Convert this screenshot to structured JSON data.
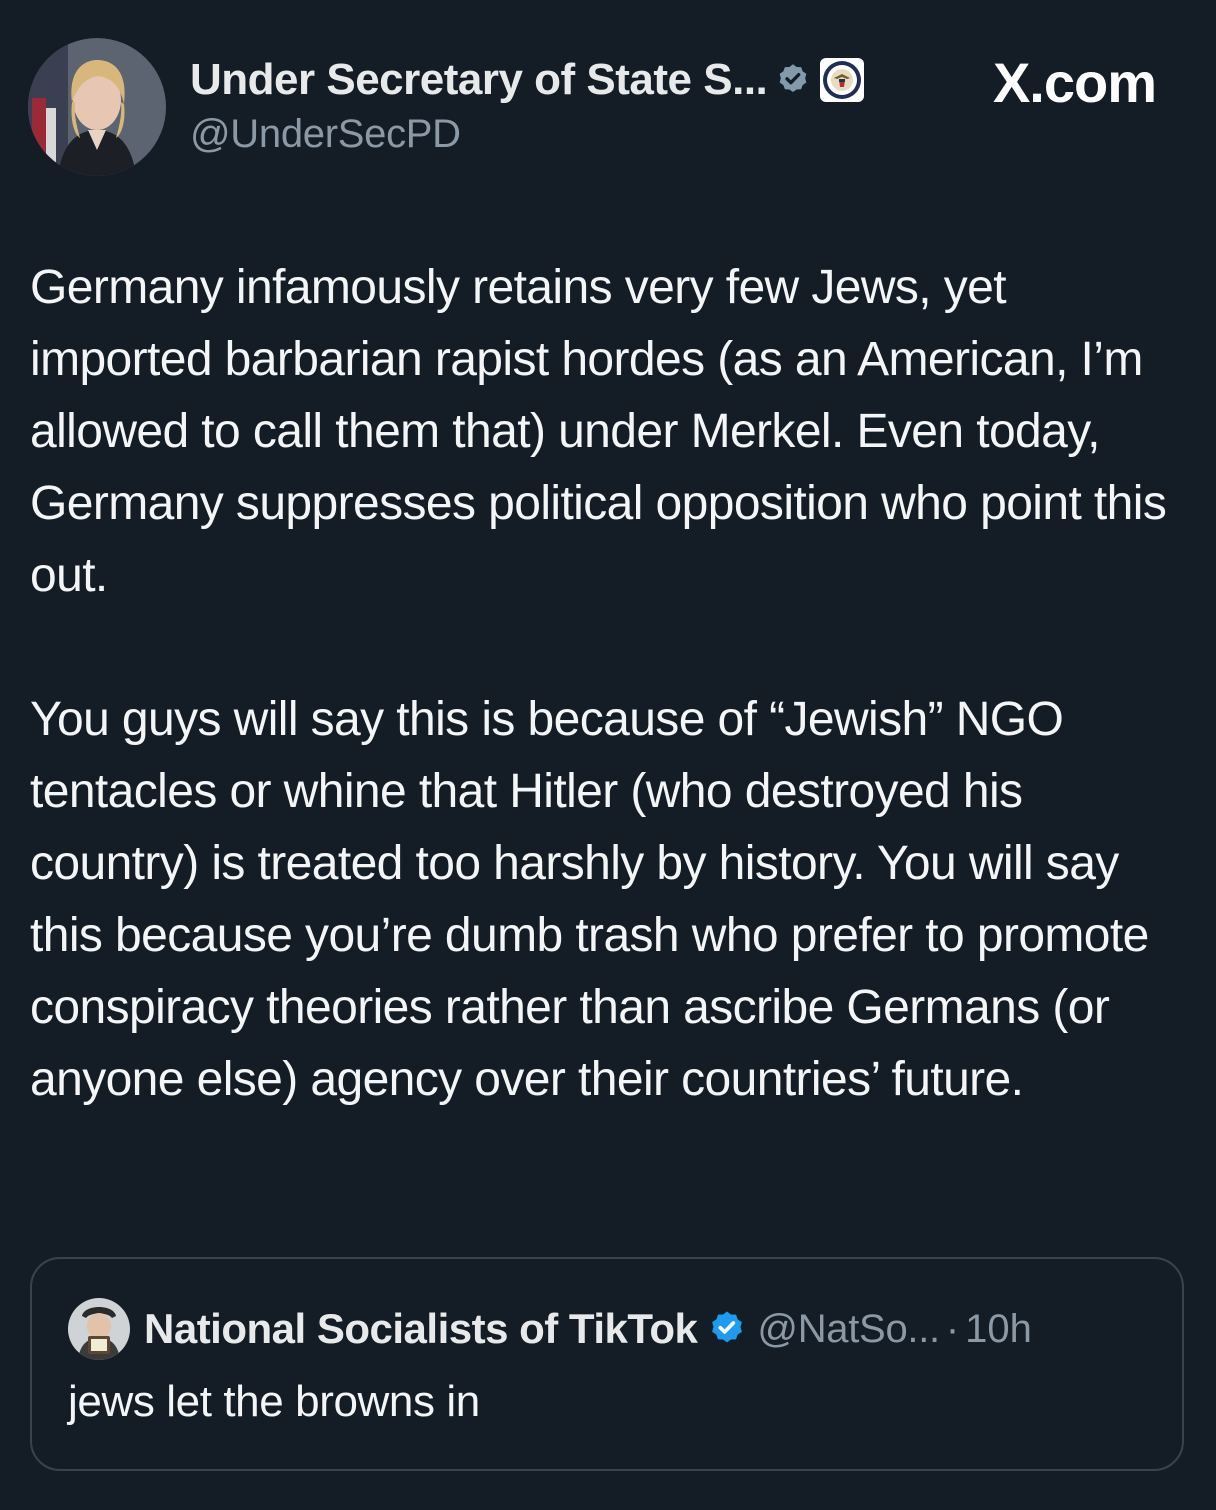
{
  "site_label": "X.com",
  "author": {
    "display_name": "Under Secretary of State S...",
    "handle": "@UnderSecPD",
    "verified_badge_icon": "gray-verified-badge-icon",
    "affiliate_icon": "state-department-seal-icon"
  },
  "tweet": {
    "paragraphs": [
      "Germany infamously retains very few Jews, yet imported barbarian rapist hordes (as an American, I’m allowed to call them that) under Merkel.  Even today, Germany suppresses political opposition who point this out.",
      "You guys will say this is because of “Jewish” NGO tentacles or whine that Hitler (who destroyed his country) is treated too harshly by history.   You will say this because you’re dumb trash who prefer to promote conspiracy theories rather than ascribe Germans (or anyone else) agency over their countries’ future."
    ]
  },
  "quoted_tweet": {
    "display_name": "National Socialists of TikTok",
    "handle": "@NatSo...",
    "separator": "·",
    "time": "10h",
    "verified_badge_icon": "blue-verified-badge-icon",
    "text": "jews let the browns in"
  },
  "colors": {
    "background": "#141d26",
    "text": "#e7e9ea",
    "muted": "#8b98a5",
    "border": "#38444d",
    "verified_blue": "#1d9bf0",
    "verified_gray": "#829aab"
  }
}
